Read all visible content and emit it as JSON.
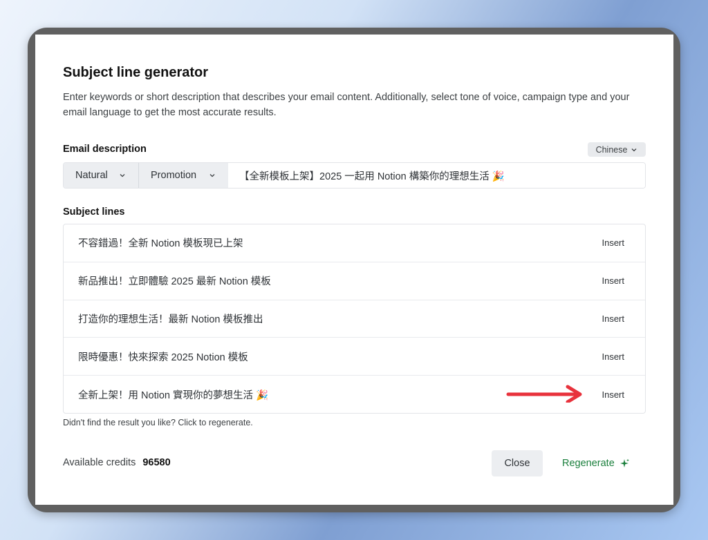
{
  "modal": {
    "title": "Subject line generator",
    "description": "Enter keywords or short description that describes your email content. Additionally, select tone of voice, campaign type and your email language to get the most accurate results.",
    "email_description_label": "Email description",
    "language": "Chinese",
    "tone": "Natural",
    "campaign_type": "Promotion",
    "email_description_value": "【全新模板上架】2025 一起用 Notion 構築你的理想生活 🎉",
    "subject_lines_label": "Subject lines",
    "subject_lines": [
      {
        "text": "不容錯過！全新 Notion 模板現已上架",
        "action": "Insert"
      },
      {
        "text": "新品推出！立即體驗 2025 最新 Notion 模板",
        "action": "Insert"
      },
      {
        "text": "打造你的理想生活！最新 Notion 模板推出",
        "action": "Insert"
      },
      {
        "text": "限時優惠！快來探索 2025 Notion 模板",
        "action": "Insert"
      },
      {
        "text": "全新上架！用 Notion 實現你的夢想生活 🎉",
        "action": "Insert"
      }
    ],
    "regenerate_hint": "Didn't find the result you like? Click to regenerate.",
    "credits_label": "Available credits",
    "credits_value": "96580",
    "close_label": "Close",
    "regenerate_label": "Regenerate"
  },
  "colors": {
    "accent_green": "#1a7f3c",
    "arrow_red": "#e8323c"
  },
  "icons": [
    "chevron-down-icon",
    "sparkle-icon",
    "arrow-right-icon"
  ]
}
